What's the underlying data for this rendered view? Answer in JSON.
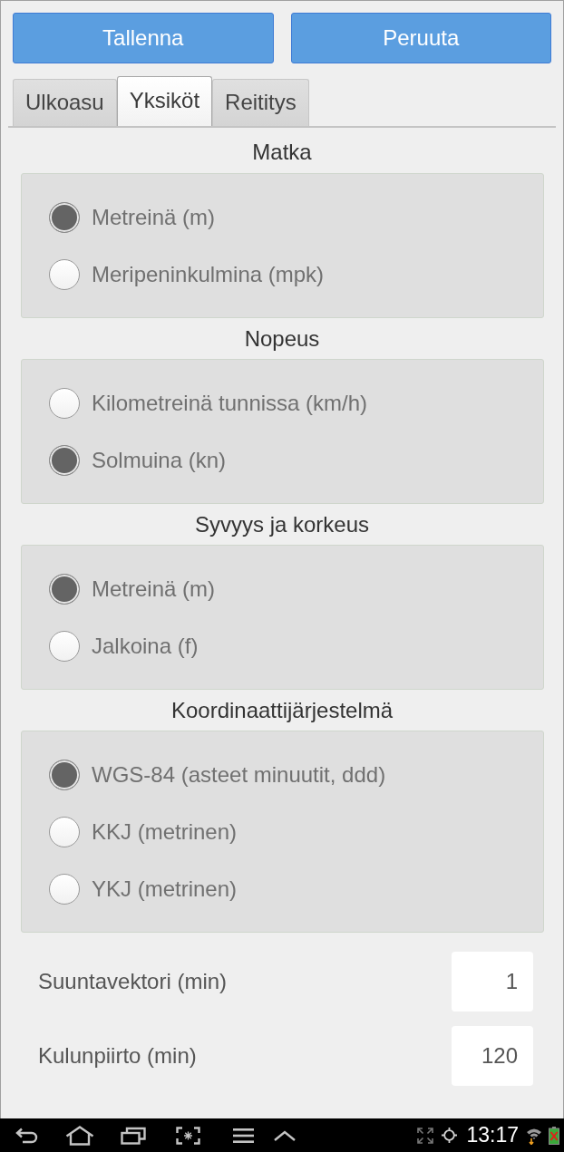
{
  "buttons": [
    {
      "label": "Tallenna"
    },
    {
      "label": "Peruuta"
    }
  ],
  "tabs": [
    {
      "label": "Ulkoasu",
      "selected": false
    },
    {
      "label": "Yksiköt",
      "selected": true
    },
    {
      "label": "Reititys",
      "selected": false
    }
  ],
  "groups": [
    {
      "title": "Matka",
      "options": [
        {
          "label": "Metreinä (m)",
          "selected": true
        },
        {
          "label": "Meripeninkulmina (mpk)",
          "selected": false
        }
      ]
    },
    {
      "title": "Nopeus",
      "options": [
        {
          "label": "Kilometreinä tunnissa (km/h)",
          "selected": false
        },
        {
          "label": "Solmuina (kn)",
          "selected": true
        }
      ]
    },
    {
      "title": "Syvyys ja korkeus",
      "options": [
        {
          "label": "Metreinä (m)",
          "selected": true
        },
        {
          "label": "Jalkoina (f)",
          "selected": false
        }
      ]
    },
    {
      "title": "Koordinaattijärjestelmä",
      "options": [
        {
          "label": "WGS-84 (asteet minuutit, ddd)",
          "selected": true
        },
        {
          "label": "KKJ (metrinen)",
          "selected": false
        },
        {
          "label": "YKJ (metrinen)",
          "selected": false
        }
      ]
    }
  ],
  "fields": [
    {
      "label": "Suuntavektori (min)",
      "value": "1"
    },
    {
      "label": "Kulunpiirto (min)",
      "value": "120"
    }
  ],
  "status_bar": {
    "time": "13:17"
  }
}
